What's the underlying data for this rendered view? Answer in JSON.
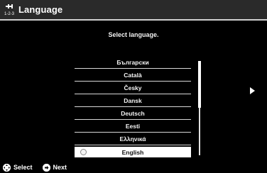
{
  "header": {
    "title": "Language",
    "icon": "language-settings-icon",
    "icon_label": "1-2-3"
  },
  "prompt": "Select language.",
  "languages": [
    "Български",
    "Català",
    "Česky",
    "Dansk",
    "Deutsch",
    "Eesti",
    "Ελληνικά",
    "English"
  ],
  "selected_language": "English",
  "footer": {
    "select_label": "Select",
    "next_label": "Next"
  },
  "colors": {
    "background": "#000000",
    "titlebar": "#2a2a2a",
    "highlight": "#ffffff"
  }
}
